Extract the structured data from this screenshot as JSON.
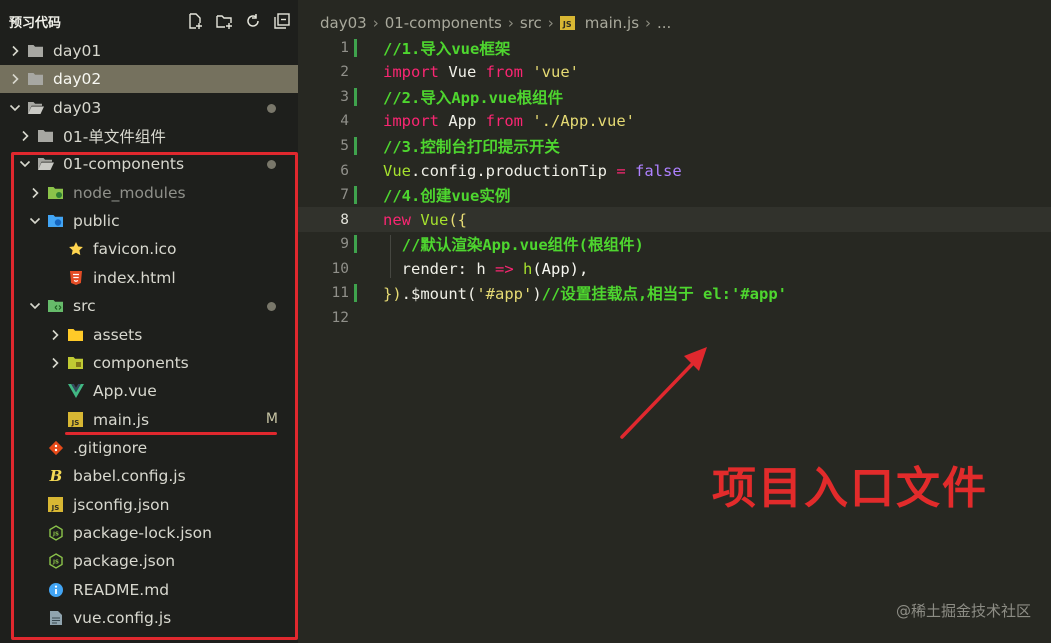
{
  "sidebar": {
    "title": "预习代码",
    "actions": [
      {
        "icon": "new-file-icon"
      },
      {
        "icon": "new-folder-icon"
      },
      {
        "icon": "refresh-icon"
      },
      {
        "icon": "collapse-all-icon"
      }
    ],
    "tree": [
      {
        "label": "day01",
        "kind": "folder",
        "open": false,
        "depth": 0
      },
      {
        "label": "day02",
        "kind": "folder",
        "open": false,
        "depth": 0,
        "selected": true
      },
      {
        "label": "day03",
        "kind": "folder",
        "open": true,
        "depth": 0,
        "badge": "dot"
      },
      {
        "label": "01-单文件组件",
        "kind": "folder",
        "open": false,
        "depth": 1
      },
      {
        "label": "01-components",
        "kind": "folder",
        "open": true,
        "depth": 1,
        "badge": "dot"
      },
      {
        "label": "node_modules",
        "kind": "node-folder",
        "open": false,
        "depth": 2,
        "muted": true
      },
      {
        "label": "public",
        "kind": "public-folder",
        "open": true,
        "depth": 2
      },
      {
        "label": "favicon.ico",
        "kind": "favicon",
        "depth": 3
      },
      {
        "label": "index.html",
        "kind": "html",
        "depth": 3
      },
      {
        "label": "src",
        "kind": "src-folder",
        "open": true,
        "depth": 2,
        "badge": "dot"
      },
      {
        "label": "assets",
        "kind": "assets-folder",
        "open": false,
        "depth": 3
      },
      {
        "label": "components",
        "kind": "components-folder",
        "open": false,
        "depth": 3
      },
      {
        "label": "App.vue",
        "kind": "vue",
        "depth": 3
      },
      {
        "label": "main.js",
        "kind": "js",
        "depth": 3,
        "badge": "M"
      },
      {
        "label": ".gitignore",
        "kind": "git",
        "depth": 2
      },
      {
        "label": "babel.config.js",
        "kind": "babel",
        "depth": 2
      },
      {
        "label": "jsconfig.json",
        "kind": "js",
        "depth": 2
      },
      {
        "label": "package-lock.json",
        "kind": "npm",
        "depth": 2
      },
      {
        "label": "package.json",
        "kind": "npm",
        "depth": 2
      },
      {
        "label": "README.md",
        "kind": "info",
        "depth": 2
      },
      {
        "label": "vue.config.js",
        "kind": "config",
        "depth": 2
      }
    ]
  },
  "breadcrumb": [
    "day03",
    "01-components",
    "src",
    "main.js",
    "..."
  ],
  "editor": {
    "current_line": 8,
    "lines": [
      {
        "n": "1",
        "mark": "added",
        "tokens": [
          [
            "comment",
            "//1.导入vue框架"
          ]
        ]
      },
      {
        "n": "2",
        "mark": "none",
        "tokens": [
          [
            "kw",
            "import"
          ],
          [
            "id",
            " Vue "
          ],
          [
            "kw",
            "from"
          ],
          [
            "id",
            " "
          ],
          [
            "str",
            "'vue'"
          ]
        ]
      },
      {
        "n": "3",
        "mark": "added",
        "tokens": [
          [
            "comment",
            "//2.导入App.vue根组件"
          ]
        ]
      },
      {
        "n": "4",
        "mark": "none",
        "tokens": [
          [
            "kw",
            "import"
          ],
          [
            "id",
            " App "
          ],
          [
            "kw",
            "from"
          ],
          [
            "id",
            " "
          ],
          [
            "str",
            "'./App.vue'"
          ]
        ]
      },
      {
        "n": "5",
        "mark": "added",
        "tokens": [
          [
            "comment",
            "//3.控制台打印提示开关"
          ]
        ]
      },
      {
        "n": "6",
        "mark": "none",
        "tokens": [
          [
            "cls",
            "Vue"
          ],
          [
            "id",
            ".config.productionTip "
          ],
          [
            "op",
            "="
          ],
          [
            "id",
            " "
          ],
          [
            "const",
            "false"
          ]
        ]
      },
      {
        "n": "7",
        "mark": "added",
        "tokens": [
          [
            "comment",
            "//4.创建vue实例"
          ]
        ]
      },
      {
        "n": "8",
        "mark": "none",
        "tokens": [
          [
            "kw",
            "new"
          ],
          [
            "id",
            " "
          ],
          [
            "cls",
            "Vue"
          ],
          [
            "str",
            "({"
          ]
        ]
      },
      {
        "n": "9",
        "mark": "added",
        "tokens": [
          [
            "id",
            "  "
          ],
          [
            "comment",
            "//默认渲染App.vue组件(根组件)"
          ]
        ]
      },
      {
        "n": "10",
        "mark": "none",
        "tokens": [
          [
            "id",
            "  render: h "
          ],
          [
            "op",
            "=>"
          ],
          [
            "id",
            " "
          ],
          [
            "cls",
            "h"
          ],
          [
            "punc",
            "(App),"
          ]
        ]
      },
      {
        "n": "11",
        "mark": "added",
        "tokens": [
          [
            "str",
            "})"
          ],
          [
            "id",
            ".$mount("
          ],
          [
            "str",
            "'#app'"
          ],
          [
            "id",
            ")"
          ],
          [
            "comment",
            "//设置挂载点,相当于 el:'#app'"
          ]
        ]
      },
      {
        "n": "12",
        "mark": "none",
        "tokens": []
      }
    ]
  },
  "annotation": {
    "text": "项目入口文件",
    "color": "#e22b2b"
  },
  "watermark": "@稀土掘金技术社区",
  "colors": {
    "sidebar_bg": "#1e1f1c",
    "editor_bg": "#272822",
    "selection": "#75715e",
    "highlight_red": "#e0282e"
  }
}
